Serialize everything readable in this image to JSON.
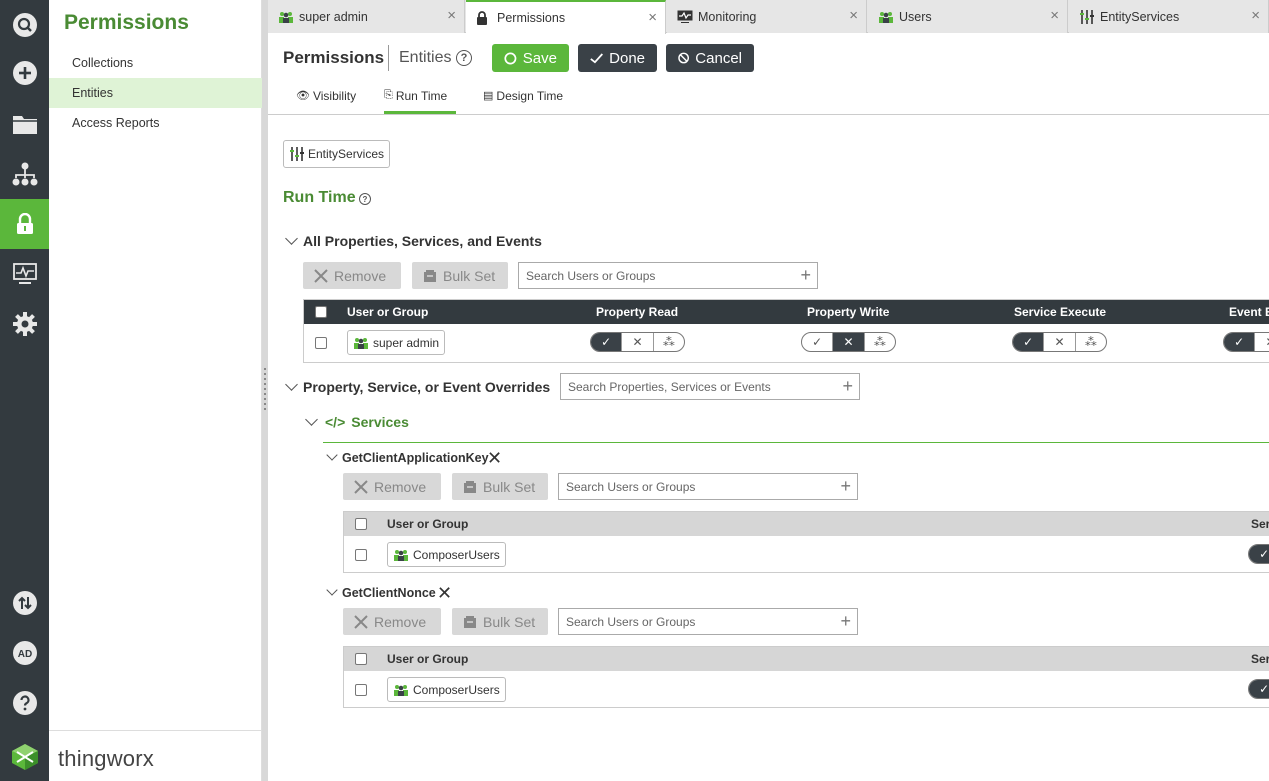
{
  "rail": {
    "items": [
      "search-icon",
      "add-icon",
      "folder-icon",
      "hierarchy-icon",
      "lock-icon",
      "monitoring-icon",
      "gear-icon",
      "import-export-icon",
      "ad-icon",
      "help-icon"
    ],
    "avatar": "AD",
    "active_color": "#5bb73b"
  },
  "subnav": {
    "title": "Permissions",
    "items": [
      {
        "label": "Collections"
      },
      {
        "label": "Entities"
      },
      {
        "label": "Access Reports"
      }
    ],
    "brand": "thingworx"
  },
  "tabs": [
    {
      "label": "super admin",
      "icon": "group-icon"
    },
    {
      "label": "Permissions",
      "icon": "lock-icon"
    },
    {
      "label": "Monitoring",
      "icon": "monitoring-icon"
    },
    {
      "label": "Users",
      "icon": "group-icon"
    },
    {
      "label": "EntityServices",
      "icon": "entity-icon"
    }
  ],
  "header": {
    "title": "Permissions",
    "entity": "Entities",
    "save": "Save",
    "done": "Done",
    "cancel": "Cancel"
  },
  "subtabs": [
    {
      "label": "Visibility"
    },
    {
      "label": "Run Time"
    },
    {
      "label": "Design Time"
    }
  ],
  "entity_chip": "EntityServices",
  "runtime": {
    "title": "Run Time",
    "all_section": {
      "title": "All Properties, Services, and Events",
      "remove": "Remove",
      "bulk_set": "Bulk Set",
      "search_placeholder": "Search Users or Groups",
      "columns": [
        "User or Group",
        "Property Read",
        "Property Write",
        "Service Execute",
        "Event E"
      ],
      "rows": [
        {
          "name": "super admin",
          "perms": [
            "allow",
            "deny",
            "allow",
            "allow"
          ]
        }
      ]
    },
    "overrides": {
      "title": "Property, Service, or Event Overrides",
      "search_placeholder": "Search Properties, Services or Events",
      "services_title": "Services",
      "services": [
        {
          "name": "GetClientApplicationKey",
          "remove": "Remove",
          "bulk_set": "Bulk Set",
          "search_placeholder": "Search Users or Groups",
          "col_user": "User or Group",
          "col_perm": "Ser",
          "rows": [
            {
              "name": "ComposerUsers"
            }
          ]
        },
        {
          "name": "GetClientNonce",
          "remove": "Remove",
          "bulk_set": "Bulk Set",
          "search_placeholder": "Search Users or Groups",
          "col_user": "User or Group",
          "col_perm": "Ser",
          "rows": [
            {
              "name": "ComposerUsers"
            }
          ]
        }
      ]
    }
  }
}
